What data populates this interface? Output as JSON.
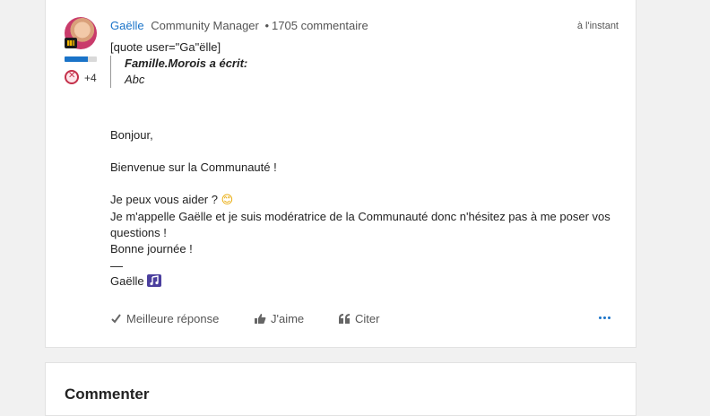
{
  "post": {
    "author": "Gaëlle",
    "role": "Community Manager",
    "separator": "•",
    "comment_count": "1705 commentaire",
    "time": "à l'instant",
    "badges_extra": "+4",
    "rank_progress": 0.72,
    "quote_open": "[quote user=\"Ga\"ëlle]",
    "quote_author": "Famille.Morois a écrit:",
    "quote_text": "Abc",
    "greeting": "Bonjour,",
    "welcome": "Bienvenue sur la Communauté !",
    "help": "Je peux vous aider ?",
    "help_emoji": "😊",
    "intro_line1": "Je m'appelle Gaëlle et je suis modératrice de la Communauté donc n'hésitez pas à me poser vos",
    "intro_line2": "questions !",
    "closing": "Bonne journée !",
    "signature": "Gaëlle",
    "signature_icon": "music-note-icon"
  },
  "actions": {
    "best_answer": "Meilleure réponse",
    "like": "J'aime",
    "quote": "Citer"
  },
  "comment_section": {
    "title": "Commenter"
  },
  "colors": {
    "accent": "#1a73c8",
    "badge": "#c4304a"
  }
}
